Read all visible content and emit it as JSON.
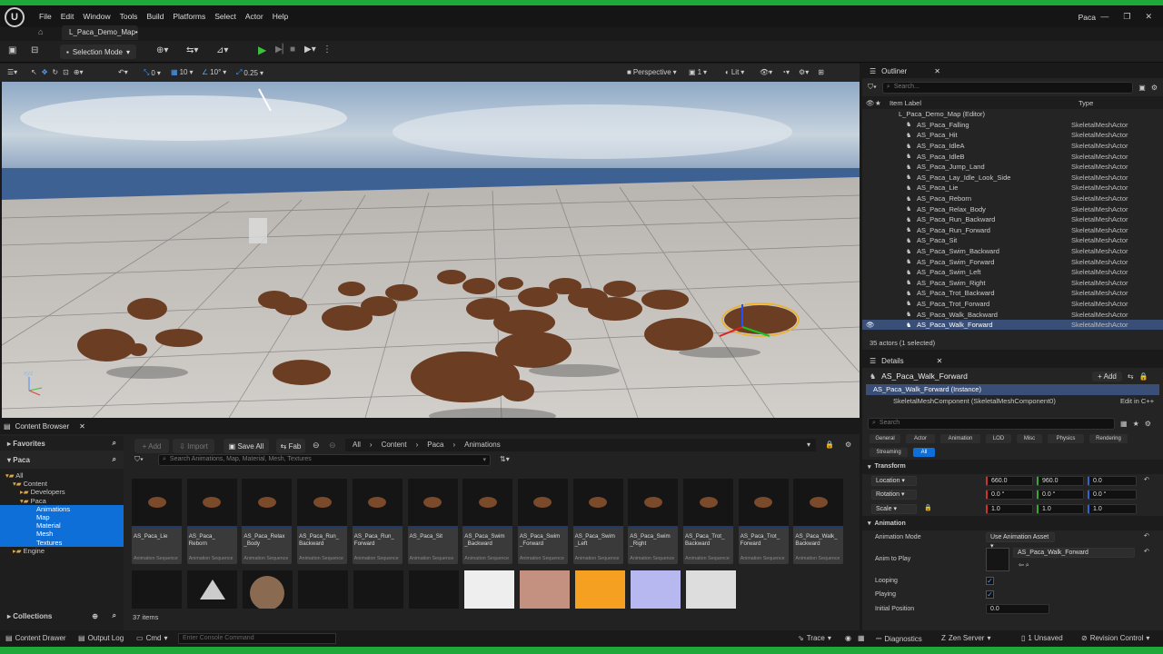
{
  "menu": {
    "logo": "U",
    "items": [
      "File",
      "Edit",
      "Window",
      "Tools",
      "Build",
      "Platforms",
      "Select",
      "Actor",
      "Help"
    ],
    "project": "Paca",
    "map_tab": "L_Paca_Demo_Map•"
  },
  "toolbar": {
    "mode": "Selection Mode"
  },
  "viewport_toolbar": {
    "translate_snap": "0",
    "grid": "10",
    "rot_snap": "10°",
    "scale_snap": "0.25",
    "view": "Perspective",
    "layout": "1",
    "lit": "Lit",
    "axis_label": "xyz"
  },
  "outliner": {
    "title": "Outliner",
    "search_placeholder": "Search...",
    "col_label": "Item Label",
    "col_type": "Type",
    "root": "L_Paca_Demo_Map (Editor)",
    "items": [
      {
        "label": "AS_Paca_Falling",
        "type": "SkeletalMeshActor"
      },
      {
        "label": "AS_Paca_Hit",
        "type": "SkeletalMeshActor"
      },
      {
        "label": "AS_Paca_IdleA",
        "type": "SkeletalMeshActor"
      },
      {
        "label": "AS_Paca_IdleB",
        "type": "SkeletalMeshActor"
      },
      {
        "label": "AS_Paca_Jump_Land",
        "type": "SkeletalMeshActor"
      },
      {
        "label": "AS_Paca_Lay_Idle_Look_Side",
        "type": "SkeletalMeshActor"
      },
      {
        "label": "AS_Paca_Lie",
        "type": "SkeletalMeshActor"
      },
      {
        "label": "AS_Paca_Reborn",
        "type": "SkeletalMeshActor"
      },
      {
        "label": "AS_Paca_Relax_Body",
        "type": "SkeletalMeshActor"
      },
      {
        "label": "AS_Paca_Run_Backward",
        "type": "SkeletalMeshActor"
      },
      {
        "label": "AS_Paca_Run_Forward",
        "type": "SkeletalMeshActor"
      },
      {
        "label": "AS_Paca_Sit",
        "type": "SkeletalMeshActor"
      },
      {
        "label": "AS_Paca_Swim_Backward",
        "type": "SkeletalMeshActor"
      },
      {
        "label": "AS_Paca_Swim_Forward",
        "type": "SkeletalMeshActor"
      },
      {
        "label": "AS_Paca_Swim_Left",
        "type": "SkeletalMeshActor"
      },
      {
        "label": "AS_Paca_Swim_Right",
        "type": "SkeletalMeshActor"
      },
      {
        "label": "AS_Paca_Trot_Backward",
        "type": "SkeletalMeshActor"
      },
      {
        "label": "AS_Paca_Trot_Forward",
        "type": "SkeletalMeshActor"
      },
      {
        "label": "AS_Paca_Walk_Backward",
        "type": "SkeletalMeshActor"
      },
      {
        "label": "AS_Paca_Walk_Forward",
        "type": "SkeletalMeshActor"
      }
    ],
    "footer": "35 actors (1 selected)"
  },
  "details": {
    "title": "Details",
    "actor_name": "AS_Paca_Walk_Forward",
    "add_label": "+ Add",
    "instance": "AS_Paca_Walk_Forward (Instance)",
    "component": "SkeletalMeshComponent (SkeletalMeshComponent0)",
    "edit_cpp": "Edit in C++",
    "search_placeholder": "Search",
    "filters": [
      "General",
      "Actor",
      "Animation",
      "LOD",
      "Misc",
      "Physics",
      "Rendering",
      "Streaming",
      "All"
    ],
    "transform_header": "Transform",
    "location_label": "Location",
    "location": [
      "660.0",
      "960.0",
      "0.0"
    ],
    "rotation_label": "Rotation",
    "rotation": [
      "0.0 °",
      "0.0 °",
      "0.0 °"
    ],
    "scale_label": "Scale",
    "scale": [
      "1.0",
      "1.0",
      "1.0"
    ],
    "animation_header": "Animation",
    "anim_mode_label": "Animation Mode",
    "anim_mode": "Use Animation Asset",
    "anim_to_play_label": "Anim to Play",
    "anim_to_play": "AS_Paca_Walk_Forward",
    "looping_label": "Looping",
    "playing_label": "Playing",
    "initial_pos_label": "Initial Position",
    "initial_pos": "0.0"
  },
  "content_browser": {
    "title": "Content Browser",
    "favorites": "Favorites",
    "project": "Paca",
    "tree": [
      "All",
      "Content",
      "Developers",
      "Paca",
      "Animations",
      "Map",
      "Material",
      "Mesh",
      "Textures",
      "Engine"
    ],
    "collections": "Collections",
    "add": "+ Add",
    "import": "Import",
    "save_all": "Save All",
    "fab": "Fab",
    "breadcrumb": [
      "All",
      "Content",
      "Paca",
      "Animations"
    ],
    "search_placeholder": "Search Animations, Map, Material, Mesh, Textures",
    "item_count": "37 items",
    "assets": [
      {
        "name": "AS_Paca_Lie",
        "cls": "Animation Sequence"
      },
      {
        "name": "AS_Paca_\nReborn",
        "cls": "Animation Sequence"
      },
      {
        "name": "AS_Paca_Relax\n_Body",
        "cls": "Animation Sequence"
      },
      {
        "name": "AS_Paca_Run_\nBackward",
        "cls": "Animation Sequence"
      },
      {
        "name": "AS_Paca_Run_\nForward",
        "cls": "Animation Sequence"
      },
      {
        "name": "AS_Paca_Sit",
        "cls": "Animation Sequence"
      },
      {
        "name": "AS_Paca_Swim\n_Backward",
        "cls": "Animation Sequence"
      },
      {
        "name": "AS_Paca_Swim\n_Forward",
        "cls": "Animation Sequence"
      },
      {
        "name": "AS_Paca_Swim\n_Left",
        "cls": "Animation Sequence"
      },
      {
        "name": "AS_Paca_Swim\n_Right",
        "cls": "Animation Sequence"
      },
      {
        "name": "AS_Paca_Trot_\nBackward",
        "cls": "Animation Sequence"
      },
      {
        "name": "AS_Paca_Trot_\nForward",
        "cls": "Animation Sequence"
      },
      {
        "name": "AS_Paca_Walk_\nBackward",
        "cls": "Animation Sequence"
      }
    ]
  },
  "statusbar": {
    "content_drawer": "Content Drawer",
    "output_log": "Output Log",
    "cmd": "Cmd",
    "console_placeholder": "Enter Console Command",
    "trace": "Trace",
    "diagnostics": "Diagnostics",
    "zen": "Zen Server",
    "unsaved": "1 Unsaved",
    "revision": "Revision Control"
  },
  "colors": {
    "accent": "#1fa83a",
    "selection": "#0e6fd8",
    "play": "#3cc13c"
  }
}
